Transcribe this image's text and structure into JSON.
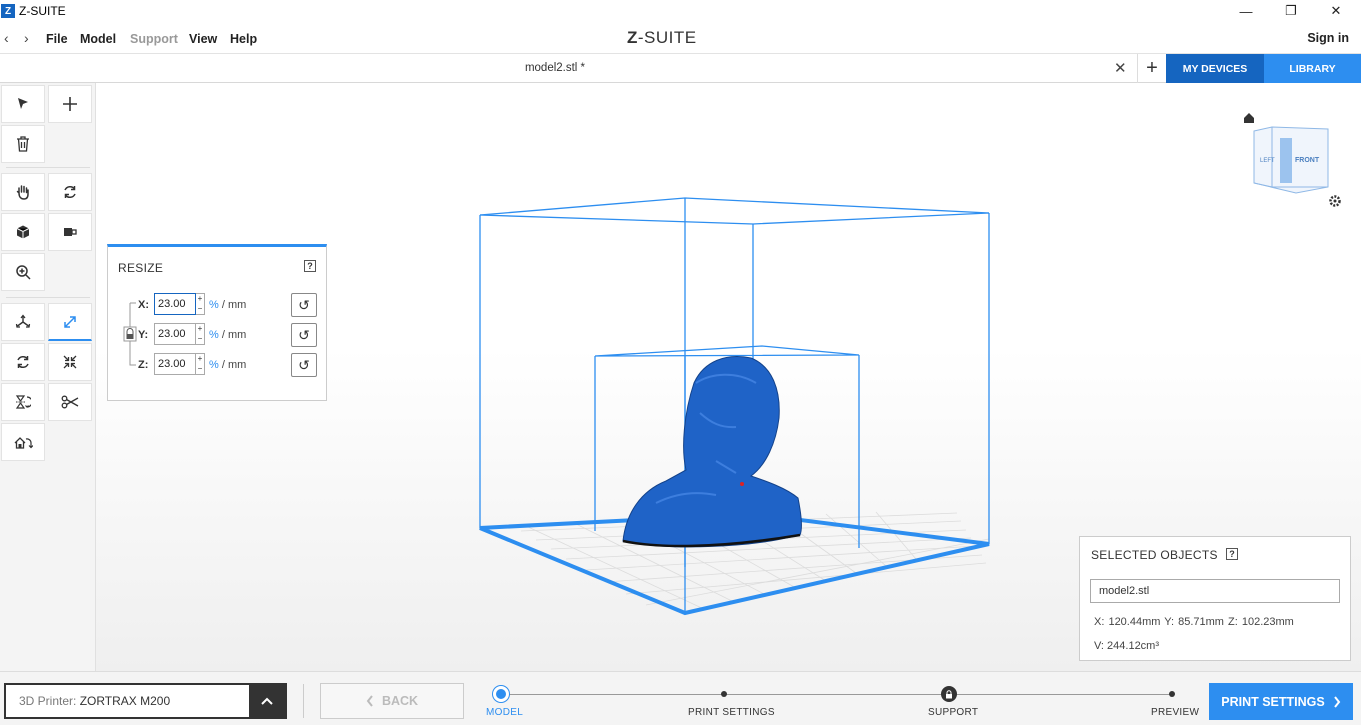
{
  "window": {
    "title": "Z-SUITE",
    "logo_letter": "Z",
    "minimize": "—",
    "restore": "❐",
    "close": "✕"
  },
  "menubar": {
    "back_arrow": "‹",
    "forward_arrow": "›",
    "items": [
      "File",
      "Model",
      "Support",
      "View",
      "Help"
    ],
    "brand_z": "Z",
    "brand_rest": "-SUITE",
    "signin": "Sign in"
  },
  "tabbar": {
    "tab_title": "model2.stl *",
    "close_glyph": "✕",
    "add_glyph": "+",
    "my_devices": "MY DEVICES",
    "library": "LIBRARY"
  },
  "resize": {
    "title": "RESIZE",
    "help": "?",
    "axes": [
      {
        "label": "X:",
        "value": "23.00"
      },
      {
        "label": "Y:",
        "value": "23.00"
      },
      {
        "label": "Z:",
        "value": "23.00"
      }
    ],
    "unit_pct": "%",
    "unit_rest": " / mm",
    "spin_up": "+",
    "spin_down": "−"
  },
  "viewcube": {
    "left": "LEFT",
    "front": "FRONT"
  },
  "selected": {
    "title": "SELECTED OBJECTS",
    "help": "?",
    "name": "model2.stl",
    "dims": "X: 120.44mm  Y: 85.71mm  Z: 102.23mm",
    "volume": "V: 244.12cm³"
  },
  "bottom": {
    "printer_prefix": "3D Printer: ",
    "printer_name": "ZORTRAX M200",
    "back": "BACK",
    "steps": [
      "MODEL",
      "PRINT SETTINGS",
      "SUPPORT",
      "PREVIEW"
    ],
    "print_settings": "PRINT SETTINGS"
  },
  "colors": {
    "accent": "#2d8ef0",
    "accent_dark": "#1565c0",
    "model": "#1f63c7"
  }
}
